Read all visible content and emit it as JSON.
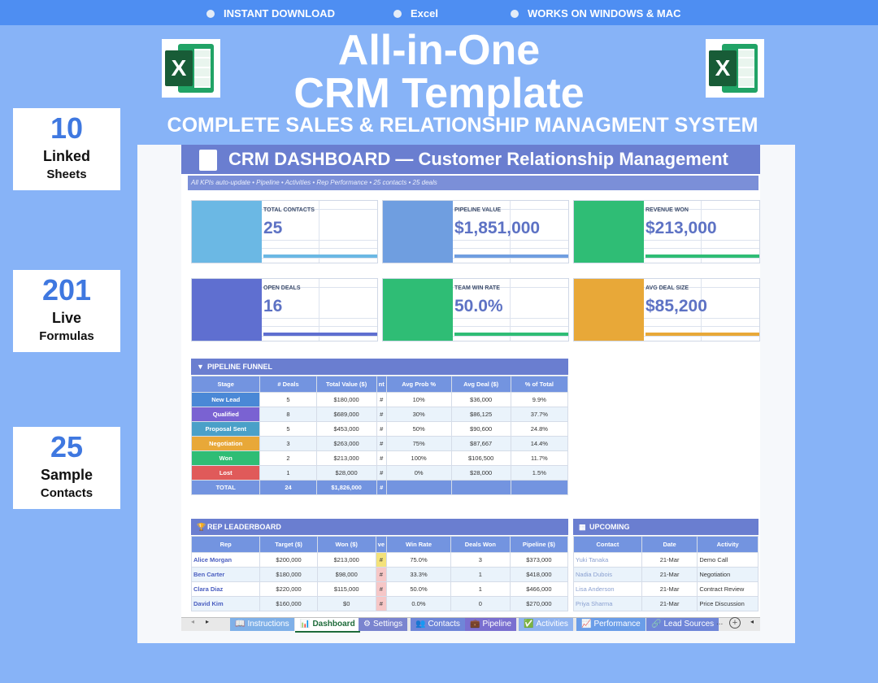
{
  "topbar": {
    "items": [
      "INSTANT DOWNLOAD",
      "Excel",
      "WORKS ON WINDOWS &  MAC"
    ]
  },
  "hero": {
    "title_line1": "All-in-One",
    "title_line2": "CRM Template",
    "subtitle": "COMPLETE SALES & RELATIONSHIP MANAGMENT SYSTEM",
    "excel_letter": "X"
  },
  "stats": [
    {
      "num": "10",
      "line1": "Linked",
      "line2": "Sheets"
    },
    {
      "num": "201",
      "line1": "Live",
      "line2": "Formulas"
    },
    {
      "num": "25",
      "line1": "Sample",
      "line2": "Contacts"
    }
  ],
  "dashboard": {
    "title": "CRM DASHBOARD  —  Customer Relationship Management",
    "subtitle": "All KPIs auto-update  •  Pipeline  •  Activities  •  Rep Performance  •  25 contacts  •  25 deals",
    "kpis": [
      {
        "label": "TOTAL CONTACTS",
        "value": "25",
        "color": "#6bb8e4",
        "bar": "#6bb8e4"
      },
      {
        "label": "PIPELINE VALUE",
        "value": "$1,851,000",
        "color": "#6f9ee0",
        "bar": "#6f9ee0"
      },
      {
        "label": "REVENUE WON",
        "value": "$213,000",
        "color": "#2fbd75",
        "bar": "#2fbd75"
      },
      {
        "label": "OPEN DEALS",
        "value": "16",
        "color": "#5f6fd0",
        "bar": "#5f6fd0"
      },
      {
        "label": "TEAM WIN RATE",
        "value": "50.0%",
        "color": "#2fbd75",
        "bar": "#2fbd75"
      },
      {
        "label": "AVG DEAL SIZE",
        "value": "$85,200",
        "color": "#e8a838",
        "bar": "#e8a838"
      }
    ],
    "funnel": {
      "title": "PIPELINE FUNNEL",
      "headers": [
        "Stage",
        "# Deals",
        "Total Value ($)",
        "nt",
        "Avg Prob %",
        "Avg Deal ($)",
        "% of Total"
      ],
      "rows": [
        {
          "stage": "New Lead",
          "color": "#4a88d6",
          "deals": "5",
          "value": "$180,000",
          "h": "#",
          "prob": "10%",
          "avg": "$36,000",
          "pct": "9.9%"
        },
        {
          "stage": "Qualified",
          "color": "#7a62d2",
          "deals": "8",
          "value": "$689,000",
          "h": "#",
          "prob": "30%",
          "avg": "$86,125",
          "pct": "37.7%"
        },
        {
          "stage": "Proposal Sent",
          "color": "#4aa0c8",
          "deals": "5",
          "value": "$453,000",
          "h": "#",
          "prob": "50%",
          "avg": "$90,600",
          "pct": "24.8%"
        },
        {
          "stage": "Negotiation",
          "color": "#e8a838",
          "deals": "3",
          "value": "$263,000",
          "h": "#",
          "prob": "75%",
          "avg": "$87,667",
          "pct": "14.4%"
        },
        {
          "stage": "Won",
          "color": "#2fbd75",
          "deals": "2",
          "value": "$213,000",
          "h": "#",
          "prob": "100%",
          "avg": "$106,500",
          "pct": "11.7%"
        },
        {
          "stage": "Lost",
          "color": "#e05a5a",
          "deals": "1",
          "value": "$28,000",
          "h": "#",
          "prob": "0%",
          "avg": "$28,000",
          "pct": "1.5%"
        }
      ],
      "total": {
        "label": "TOTAL",
        "deals": "24",
        "value": "$1,826,000",
        "h": "#"
      }
    },
    "leaderboard": {
      "title": "REP LEADERBOARD",
      "headers": [
        "Rep",
        "Target ($)",
        "Won ($)",
        "ve",
        "Win Rate",
        "Deals Won",
        "Pipeline ($)"
      ],
      "rows": [
        {
          "rep": "Alice Morgan",
          "target": "$200,000",
          "won": "$213,000",
          "h": "#",
          "rate": "75.0%",
          "deals": "3",
          "pipe": "$373,000"
        },
        {
          "rep": "Ben Carter",
          "target": "$180,000",
          "won": "$98,000",
          "h": "#",
          "rate": "33.3%",
          "deals": "1",
          "pipe": "$418,000"
        },
        {
          "rep": "Clara Diaz",
          "target": "$220,000",
          "won": "$115,000",
          "h": "#",
          "rate": "50.0%",
          "deals": "1",
          "pipe": "$466,000"
        },
        {
          "rep": "David Kim",
          "target": "$160,000",
          "won": "$0",
          "h": "#",
          "rate": "0.0%",
          "deals": "0",
          "pipe": "$270,000"
        }
      ]
    },
    "upcoming": {
      "title": "UPCOMING",
      "headers": [
        "Contact",
        "Date",
        "Activity"
      ],
      "rows": [
        {
          "contact": "Yuki Tanaka",
          "date": "21-Mar",
          "activity": "Demo Call"
        },
        {
          "contact": "Nadia Dubois",
          "date": "21-Mar",
          "activity": "Negotiation"
        },
        {
          "contact": "Lisa Anderson",
          "date": "21-Mar",
          "activity": "Contract Review"
        },
        {
          "contact": "Priya Sharma",
          "date": "21-Mar",
          "activity": "Price Discussion"
        }
      ]
    },
    "tabs": [
      {
        "label": "Instructions",
        "icon": "📖",
        "color": "#7fb0e8",
        "active": false
      },
      {
        "label": "Dashboard",
        "icon": "📊",
        "color": "#ffffff",
        "active": true
      },
      {
        "label": "Settings",
        "icon": "⚙",
        "color": "#7a84cf",
        "active": false
      },
      {
        "label": "Contacts",
        "icon": "👥",
        "color": "#6f86d8",
        "active": false
      },
      {
        "label": "Pipeline",
        "icon": "💼",
        "color": "#7a6fd0",
        "active": false
      },
      {
        "label": "Activities",
        "icon": "✅",
        "color": "#8fb3f0",
        "active": false
      },
      {
        "label": "Performance",
        "icon": "📈",
        "color": "#6a9de8",
        "active": false
      },
      {
        "label": "Lead Sources",
        "icon": "🔗",
        "color": "#6f86d8",
        "active": false
      }
    ],
    "tab_more": "..."
  }
}
